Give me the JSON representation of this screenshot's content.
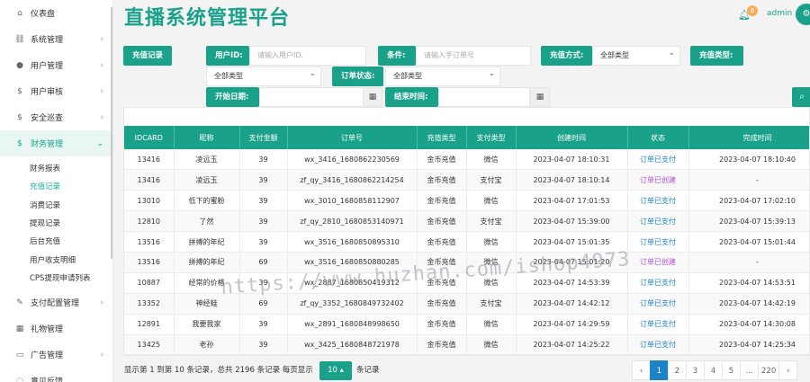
{
  "header": {
    "title": "直播系统管理平台",
    "notification_count": "6",
    "user": "admin"
  },
  "sidebar": {
    "items": [
      {
        "label": "仪表盘",
        "icon": "home-icon",
        "glyph": "⌂",
        "arrow": ""
      },
      {
        "label": "系统管理",
        "icon": "sitemap-icon",
        "glyph": "⛓",
        "arrow": "›"
      },
      {
        "label": "用户管理",
        "icon": "user-icon",
        "glyph": "●",
        "arrow": "›"
      },
      {
        "label": "用户审核",
        "icon": "dollar-icon",
        "glyph": "$",
        "arrow": "›"
      },
      {
        "label": "安全巡查",
        "icon": "dollar-icon",
        "glyph": "$",
        "arrow": "›"
      },
      {
        "label": "财务管理",
        "icon": "dollar-icon",
        "glyph": "$",
        "arrow": "⌄"
      }
    ],
    "submenu": [
      "财务报表",
      "充值记录",
      "消费记录",
      "提现记录",
      "后台充值",
      "用户收支明细",
      "CPS提现申请列表"
    ],
    "items_after": [
      {
        "label": "支付配置管理",
        "icon": "wrench-icon",
        "glyph": "✎",
        "arrow": "›"
      },
      {
        "label": "礼物管理",
        "icon": "gift-icon",
        "glyph": "▦",
        "arrow": ""
      },
      {
        "label": "广告管理",
        "icon": "ad-icon",
        "glyph": "▭",
        "arrow": "›"
      },
      {
        "label": "意见反馈",
        "icon": "feedback-icon",
        "glyph": "◌",
        "arrow": ""
      }
    ]
  },
  "filters": {
    "recharge_record_label": "充值记录",
    "user_id_label": "用户ID:",
    "user_id_placeholder": "请输入用户ID.",
    "condition_label": "条件:",
    "order_placeholder": "请输入手订单号",
    "method_label": "充值方式:",
    "method_value": "全部类型",
    "type_label": "充值类型:",
    "type_value": "全部类型",
    "order_status_label": "订单状态:",
    "order_status_value": "全部类型",
    "start_date_label": "开始日期:",
    "end_time_label": "结束时间:"
  },
  "table": {
    "columns": [
      "IDCARD",
      "昵称",
      "支付金额",
      "订单号",
      "充值类型",
      "支付类型",
      "创建时间",
      "状态",
      "完成时间"
    ],
    "rows": [
      [
        "13416",
        "凌远玉",
        "39",
        "wx_3416_1680862230569",
        "金币充值",
        "微信",
        "2023-04-07 18:10:31",
        "订单已支付",
        "2023-04-07 18:10:40"
      ],
      [
        "13416",
        "凌远玉",
        "39",
        "zf_qy_3416_1680862214254",
        "金币充值",
        "支付宝",
        "2023-04-07 18:10:14",
        "订单已创建",
        "-"
      ],
      [
        "13010",
        "低下的蜜粉",
        "39",
        "wx_3010_1680858112907",
        "金币充值",
        "微信",
        "2023-04-07 17:01:53",
        "订单已支付",
        "2023-04-07 17:02:10"
      ],
      [
        "12810",
        "了然",
        "39",
        "zf_qy_2810_1680853140971",
        "金币充值",
        "支付宝",
        "2023-04-07 15:39:00",
        "订单已支付",
        "2023-04-07 15:39:13"
      ],
      [
        "13516",
        "拼搏的年纪",
        "39",
        "wx_3516_1680850895310",
        "金币充值",
        "微信",
        "2023-04-07 15:01:35",
        "订单已支付",
        "2023-04-07 15:01:44"
      ],
      [
        "13516",
        "拼搏的年纪",
        "69",
        "wx_3516_1680850880285",
        "金币充值",
        "微信",
        "2023-04-07 15:01:20",
        "订单已创建",
        "-"
      ],
      [
        "10887",
        "经常的价格",
        "39",
        "wx_2887_1680850419312",
        "金币充值",
        "微信",
        "2023-04-07 14:53:39",
        "订单已支付",
        "2023-04-07 14:53:51"
      ],
      [
        "13352",
        "神经蛙",
        "69",
        "zf_qy_3352_1680849732402",
        "金币充值",
        "支付宝",
        "2023-04-07 14:42:12",
        "订单已支付",
        "2023-04-07 14:42:19"
      ],
      [
        "12891",
        "我要我家",
        "39",
        "wx_2891_1680848998650",
        "金币充值",
        "微信",
        "2023-04-07 14:29:59",
        "订单已支付",
        "2023-04-07 14:30:08"
      ],
      [
        "13425",
        "老孙",
        "39",
        "wx_3425_1680848721978",
        "金币充值",
        "微信",
        "2023-04-07 14:25:22",
        "订单已支付",
        "2023-04-07 14:25:34"
      ]
    ]
  },
  "footer": {
    "info": "显示第 1 到第 10 条记录，总共 2196 条记录 每页显示",
    "page_size": "10 ▴",
    "tail": "条记录",
    "pages": [
      "‹",
      "1",
      "2",
      "3",
      "4",
      "5",
      "...",
      "220",
      "›"
    ]
  },
  "watermark": "https://www.huzhan.com/ishop4973",
  "colors": {
    "accent": "#1aa189",
    "paid": "#1c84c6",
    "created": "#b04fd6",
    "badge": "#f8ac59"
  }
}
